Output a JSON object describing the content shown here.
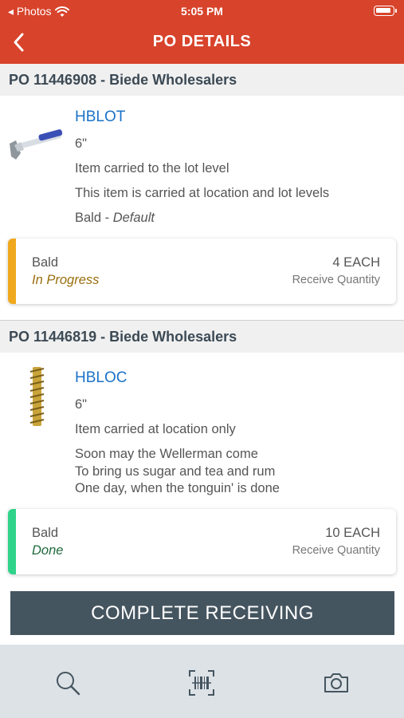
{
  "status_bar": {
    "back_app": "◂ Photos",
    "time": "5:05 PM"
  },
  "nav": {
    "title": "PO DETAILS",
    "back_icon": "chevron-left-icon"
  },
  "orders": [
    {
      "header": "PO 11446908 - Biede Wholesalers",
      "item": {
        "code": "HBLOT",
        "size": "6\"",
        "description_lines": [
          "Item carried to the lot level",
          "This item is carried at location and lot levels"
        ],
        "location": "Bald",
        "location_suffix": "Default",
        "icon": "hammer-icon"
      },
      "receipt": {
        "location": "Bald",
        "status": "In Progress",
        "status_color": "#f0a91e",
        "status_text_color": "#9a6e0e",
        "quantity": "4 EACH",
        "quantity_label": "Receive Quantity"
      }
    },
    {
      "header": "PO 11446819 - Biede Wholesalers",
      "item": {
        "code": "HBLOC",
        "size": "6\"",
        "description_lines": [
          "Item carried at location only"
        ],
        "notes_lines": [
          "Soon may the Wellerman come",
          "To bring us sugar and tea and rum",
          "One day, when the tonguin' is done"
        ],
        "icon": "screw-icon"
      },
      "receipt": {
        "location": "Bald",
        "status": "Done",
        "status_color": "#2fd38a",
        "status_text_color": "#1f6b3e",
        "quantity": "10 EACH",
        "quantity_label": "Receive Quantity"
      }
    }
  ],
  "complete_button": {
    "label": "COMPLETE RECEIVING"
  },
  "tab_bar": {
    "icons": [
      "search-icon",
      "barcode-scan-icon",
      "camera-icon"
    ]
  },
  "colors": {
    "brand": "#d8432b",
    "header_bg": "#f0f0f0",
    "button": "#455560",
    "link": "#1a73c8",
    "tabbar": "#dde2e6"
  }
}
